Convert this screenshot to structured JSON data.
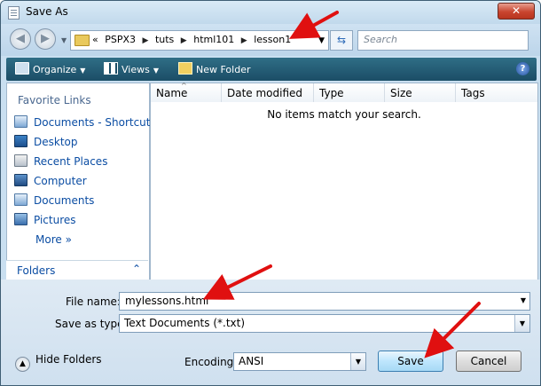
{
  "window": {
    "title": "Save As",
    "close_label": "✕"
  },
  "address": {
    "overflow": "«",
    "crumbs": [
      "PSPX3",
      "tuts",
      "html101",
      "lesson1"
    ],
    "search_placeholder": "Search"
  },
  "toolbar": {
    "organize": "Organize",
    "views": "Views",
    "new_folder": "New Folder",
    "help": "?"
  },
  "sidebar": {
    "header": "Favorite Links",
    "items": [
      {
        "label": "Documents - Shortcut",
        "icon": "documents-shortcut-icon"
      },
      {
        "label": "Desktop",
        "icon": "desktop-icon"
      },
      {
        "label": "Recent Places",
        "icon": "recent-places-icon"
      },
      {
        "label": "Computer",
        "icon": "computer-icon"
      },
      {
        "label": "Documents",
        "icon": "documents-icon"
      },
      {
        "label": "Pictures",
        "icon": "pictures-icon"
      }
    ],
    "more": "More",
    "more_glyph": "»",
    "folders": "Folders",
    "folders_glyph": "⌃"
  },
  "filelist": {
    "columns": [
      "Name",
      "Date modified",
      "Type",
      "Size",
      "Tags"
    ],
    "empty_message": "No items match your search."
  },
  "form": {
    "file_name_label": "File name:",
    "file_name_value": "mylessons.html",
    "save_type_label": "Save as type:",
    "save_type_value": "Text Documents (*.txt)",
    "encoding_label": "Encoding:",
    "encoding_value": "ANSI",
    "save_button": "Save",
    "cancel_button": "Cancel",
    "hide_folders": "Hide Folders"
  },
  "colors": {
    "toolbar": "#1b4d66",
    "link": "#0b4da3",
    "annotation_arrow": "#e01010"
  }
}
